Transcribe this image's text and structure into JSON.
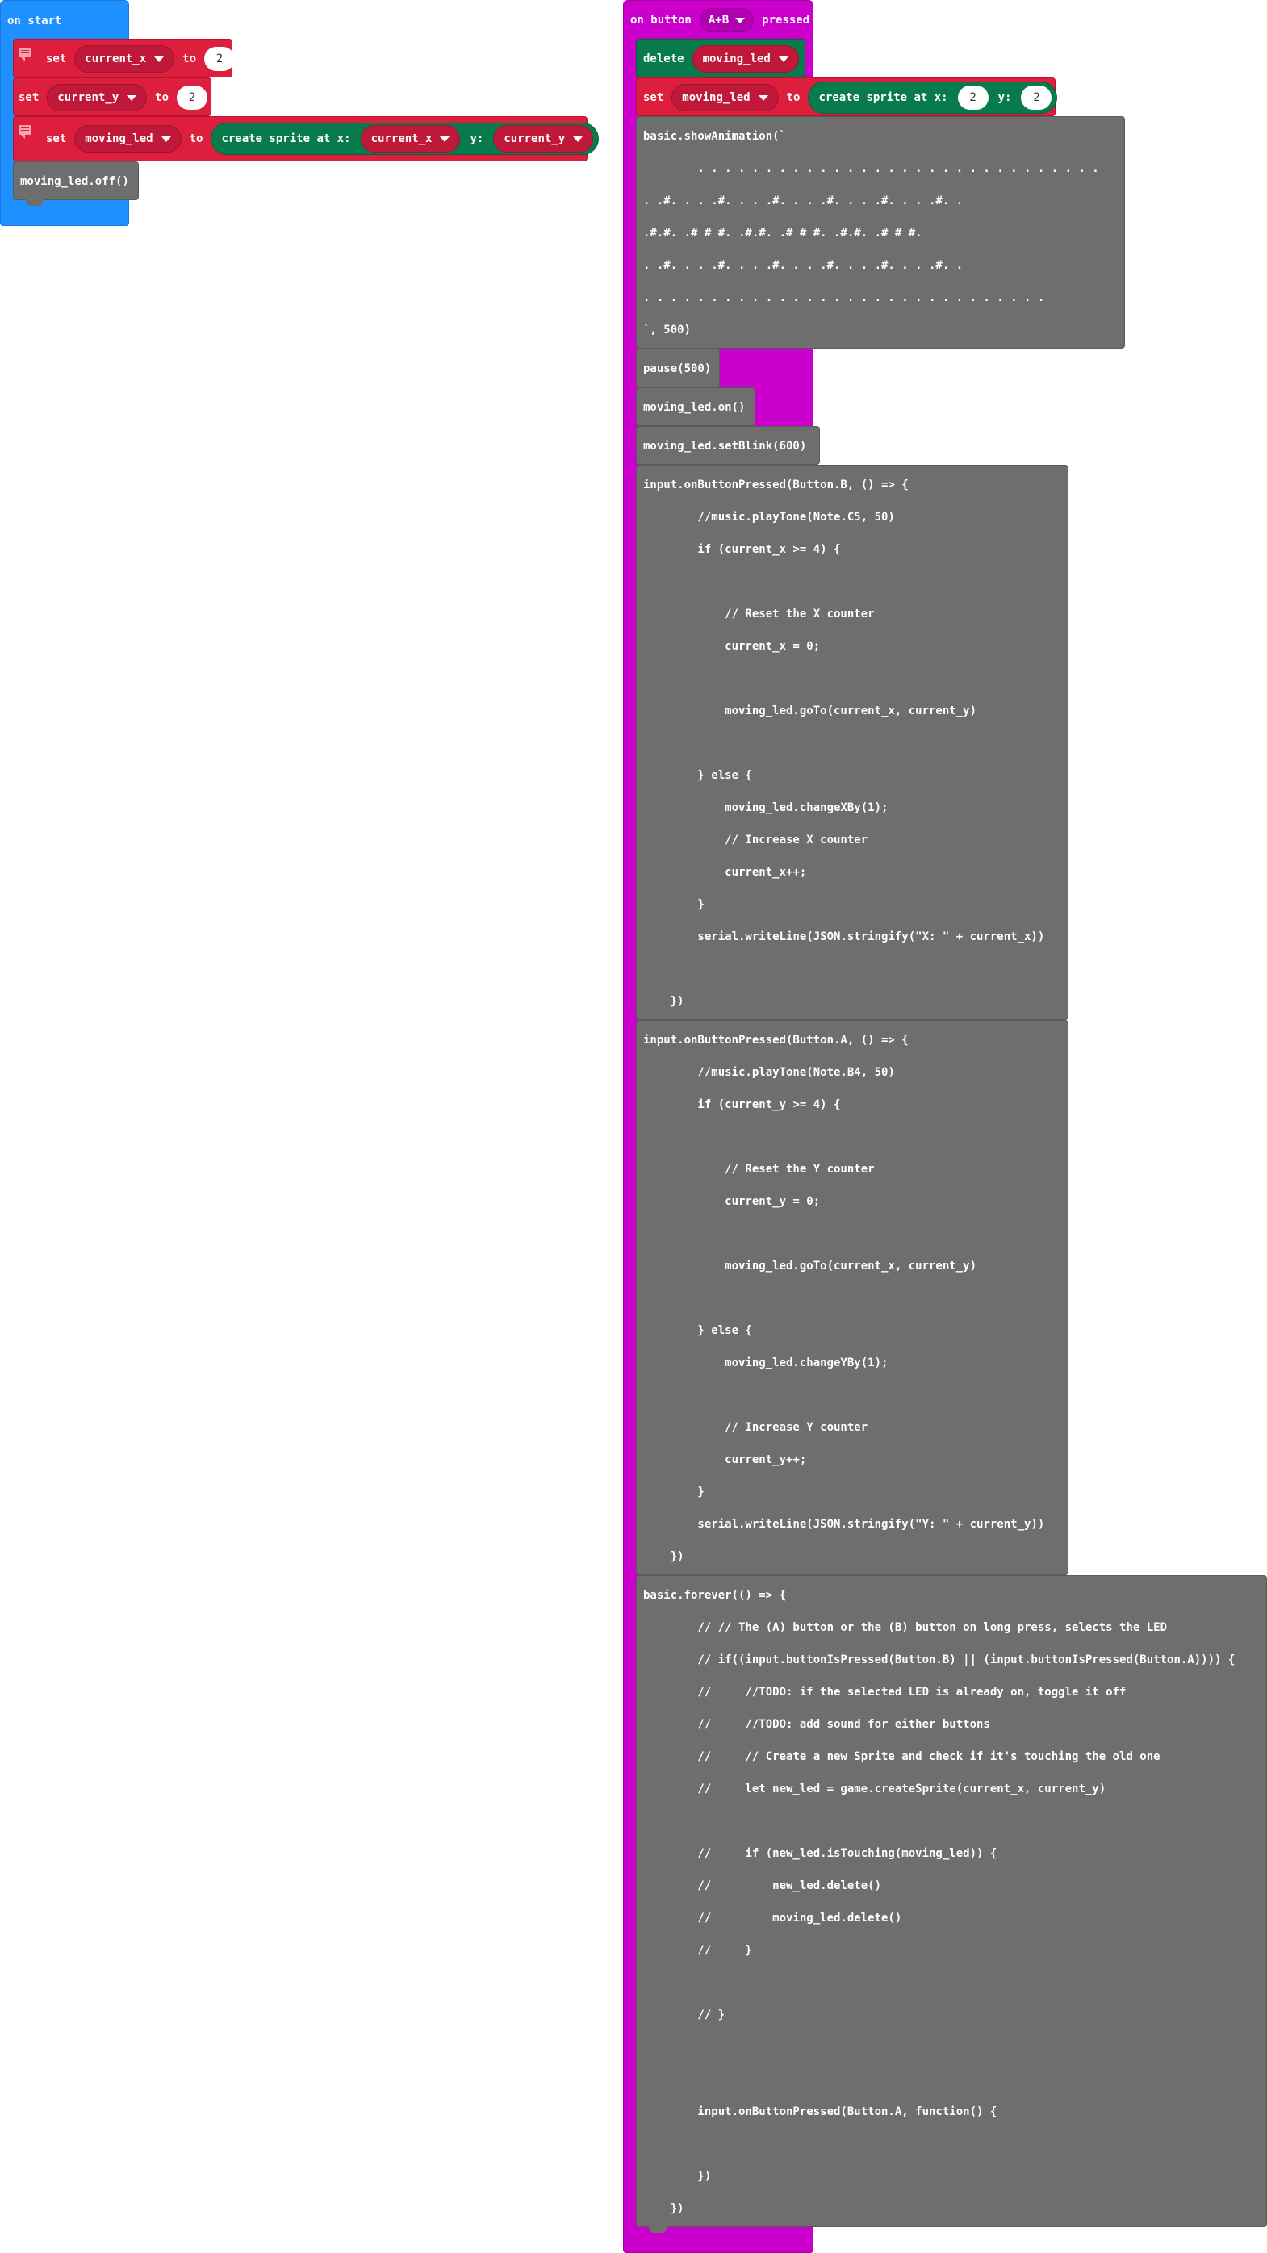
{
  "on_start": {
    "hat_label": "on start",
    "set_keyword": "set",
    "to_keyword": "to",
    "rows": [
      {
        "variable": "current_x",
        "value": "2"
      },
      {
        "variable": "current_y",
        "value": "2"
      }
    ],
    "sprite_row": {
      "variable": "moving_led",
      "create_label": "create sprite at x:",
      "x_var": "current_x",
      "y_label": "y:",
      "y_var": "current_y"
    },
    "off_call": "moving_led.off()"
  },
  "on_button": {
    "hat_prefix": "on button",
    "button_option": "A+B",
    "hat_suffix": "pressed",
    "delete_keyword": "delete",
    "delete_var": "moving_led",
    "set_keyword": "set",
    "set_var": "moving_led",
    "to_keyword": "to",
    "create_label": "create sprite at x:",
    "x_value": "2",
    "y_label": "y:",
    "y_value": "2",
    "animation_lines": [
      "basic.showAnimation(`",
      "        . . . . . . . . . . . . . . . . . . . . . . . . . . . . . .",
      ". .#. . . .#. . . .#. . . .#. . . .#. . . .#. .",
      ".#.#. .# # #. .#.#. .# # #. .#.#. .# # #.",
      ". .#. . . .#. . . .#. . . .#. . . .#. . . .#. .",
      ". . . . . . . . . . . . . . . . . . . . . . . . . . . . . .",
      "`, 500)"
    ],
    "pause_call": "pause(500)",
    "on_call": "moving_led.on()",
    "blink_call": "moving_led.setBlink(600)",
    "button_b_lines": [
      "input.onButtonPressed(Button.B, () => {",
      "        //music.playTone(Note.C5, 50)",
      "        if (current_x >= 4) {",
      "",
      "            // Reset the X counter",
      "            current_x = 0;",
      "",
      "            moving_led.goTo(current_x, current_y)",
      "",
      "        } else {",
      "            moving_led.changeXBy(1);",
      "            // Increase X counter",
      "            current_x++;",
      "        }",
      "        serial.writeLine(JSON.stringify(\"X: \" + current_x))",
      "",
      "    })"
    ],
    "button_a_lines": [
      "input.onButtonPressed(Button.A, () => {",
      "        //music.playTone(Note.B4, 50)",
      "        if (current_y >= 4) {",
      "",
      "            // Reset the Y counter",
      "            current_y = 0;",
      "",
      "            moving_led.goTo(current_x, current_y)",
      "",
      "        } else {",
      "            moving_led.changeYBy(1);",
      "",
      "            // Increase Y counter",
      "            current_y++;",
      "        }",
      "        serial.writeLine(JSON.stringify(\"Y: \" + current_y))",
      "    })"
    ],
    "forever_lines": [
      "basic.forever(() => {",
      "        // // The (A) button or the (B) button on long press, selects the LED",
      "        // if((input.buttonIsPressed(Button.B) || (input.buttonIsPressed(Button.A)))) {",
      "        //     //TODO: if the selected LED is already on, toggle it off",
      "        //     //TODO: add sound for either buttons",
      "        //     // Create a new Sprite and check if it's touching the old one",
      "        //     let new_led = game.createSprite(current_x, current_y)",
      "",
      "        //     if (new_led.isTouching(moving_led)) {",
      "        //         new_led.delete()",
      "        //         moving_led.delete()",
      "        //     }",
      "",
      "        // }",
      "",
      "",
      "        input.onButtonPressed(Button.A, function() {",
      "",
      "        })",
      "    })"
    ]
  }
}
